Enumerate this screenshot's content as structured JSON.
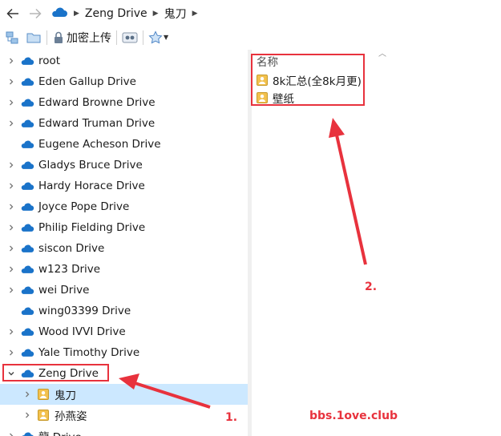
{
  "address_bar": {
    "breadcrumbs": [
      "Zeng Drive",
      "鬼刀"
    ]
  },
  "toolbar": {
    "encrypt_upload_label": "加密上传"
  },
  "tree": {
    "items": [
      {
        "label": "root",
        "expandable": true
      },
      {
        "label": "Eden Gallup Drive",
        "expandable": true
      },
      {
        "label": "Edward Browne Drive",
        "expandable": true
      },
      {
        "label": "Edward Truman Drive",
        "expandable": true
      },
      {
        "label": "Eugene Acheson Drive",
        "expandable": false
      },
      {
        "label": "Gladys Bruce Drive",
        "expandable": true
      },
      {
        "label": "Hardy Horace Drive",
        "expandable": true
      },
      {
        "label": "Joyce Pope Drive",
        "expandable": true
      },
      {
        "label": "Philip Fielding Drive",
        "expandable": true
      },
      {
        "label": "siscon Drive",
        "expandable": true
      },
      {
        "label": "w123 Drive",
        "expandable": true
      },
      {
        "label": "wei Drive",
        "expandable": true
      },
      {
        "label": "wing03399 Drive",
        "expandable": false
      },
      {
        "label": "Wood IVVI Drive",
        "expandable": true
      },
      {
        "label": "Yale Timothy Drive",
        "expandable": true
      },
      {
        "label": "Zeng Drive",
        "expandable": true,
        "expanded": true
      },
      {
        "label": "鬼刀",
        "child": true,
        "selected": true
      },
      {
        "label": "孙燕姿",
        "child": true
      },
      {
        "label": "龍 Drive",
        "expandable": true
      }
    ]
  },
  "content": {
    "column_header": "名称",
    "files": [
      "8k汇总(全8k月更)",
      "壁纸"
    ]
  },
  "annotations": {
    "label_1": "1.",
    "label_2": "2.",
    "watermark": "bbs.1ove.club",
    "color": "#e8323d"
  },
  "colors": {
    "cloud": "#1a73c9",
    "folder": "#f2c14e",
    "selection": "#cce8ff"
  }
}
